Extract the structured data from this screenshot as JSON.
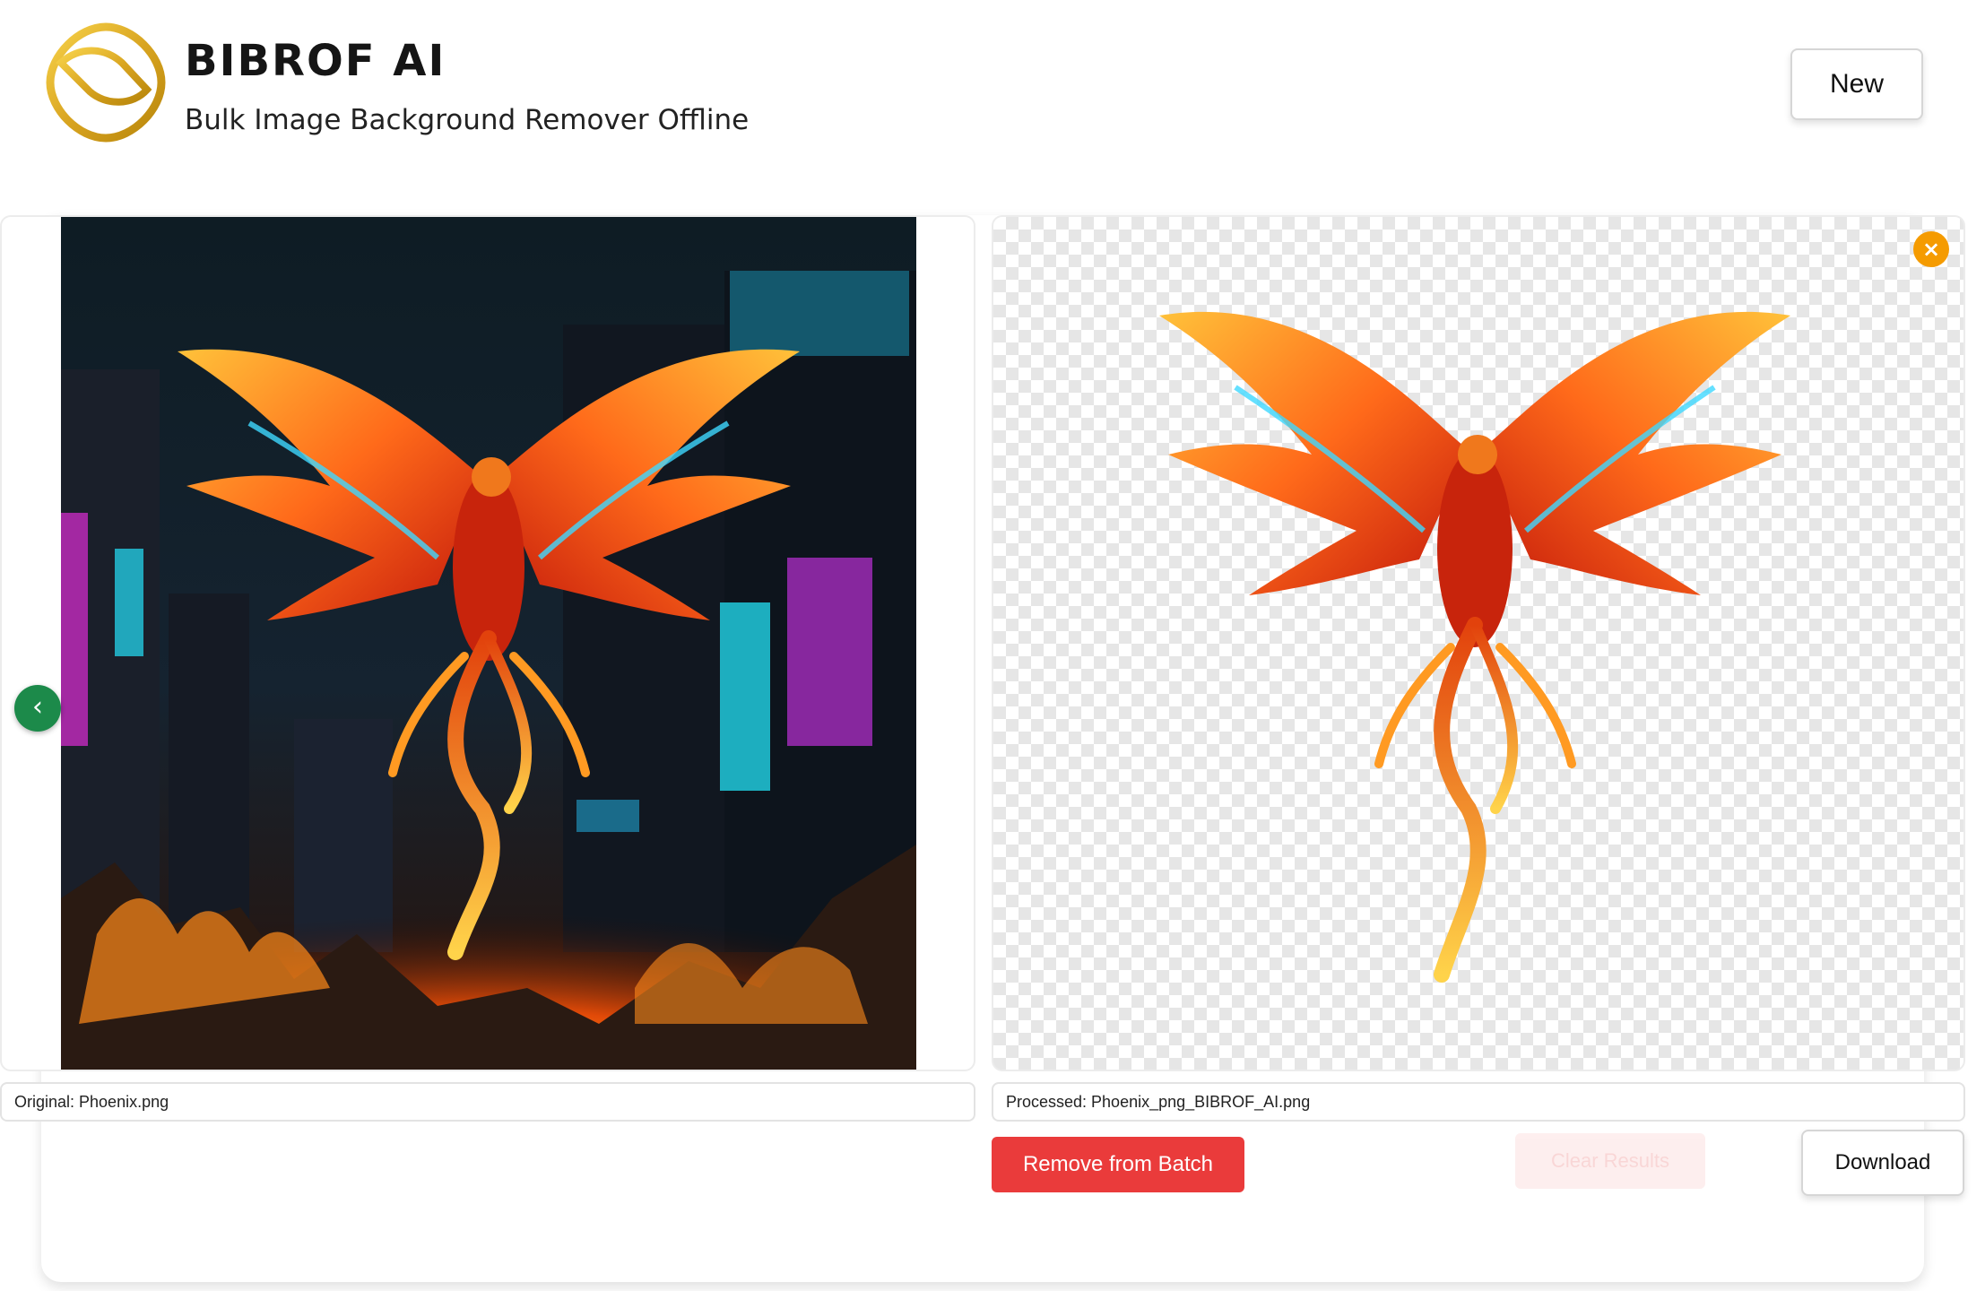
{
  "header": {
    "brand_title": "BIBROF AI",
    "brand_subtitle": "Bulk Image Background Remover Offline",
    "new_button": "New",
    "logo_icon": "gold-ring-logo-icon"
  },
  "viewer": {
    "original_caption": "Original: Phoenix.png",
    "processed_caption": "Processed: Phoenix_png_BIBROF_AI.png",
    "prev_icon": "chevron-left-icon",
    "prev_glyph": "‹",
    "close_icon": "close-icon",
    "close_glyph": "×"
  },
  "actions": {
    "remove_from_batch": "Remove from Batch",
    "clear_results": "Clear Results",
    "download": "Download"
  },
  "colors": {
    "remove_button": "#ea3b3b",
    "prev_button": "#1c8a4a",
    "close_button": "#f59b00",
    "logo_gold": "#d9a521"
  }
}
